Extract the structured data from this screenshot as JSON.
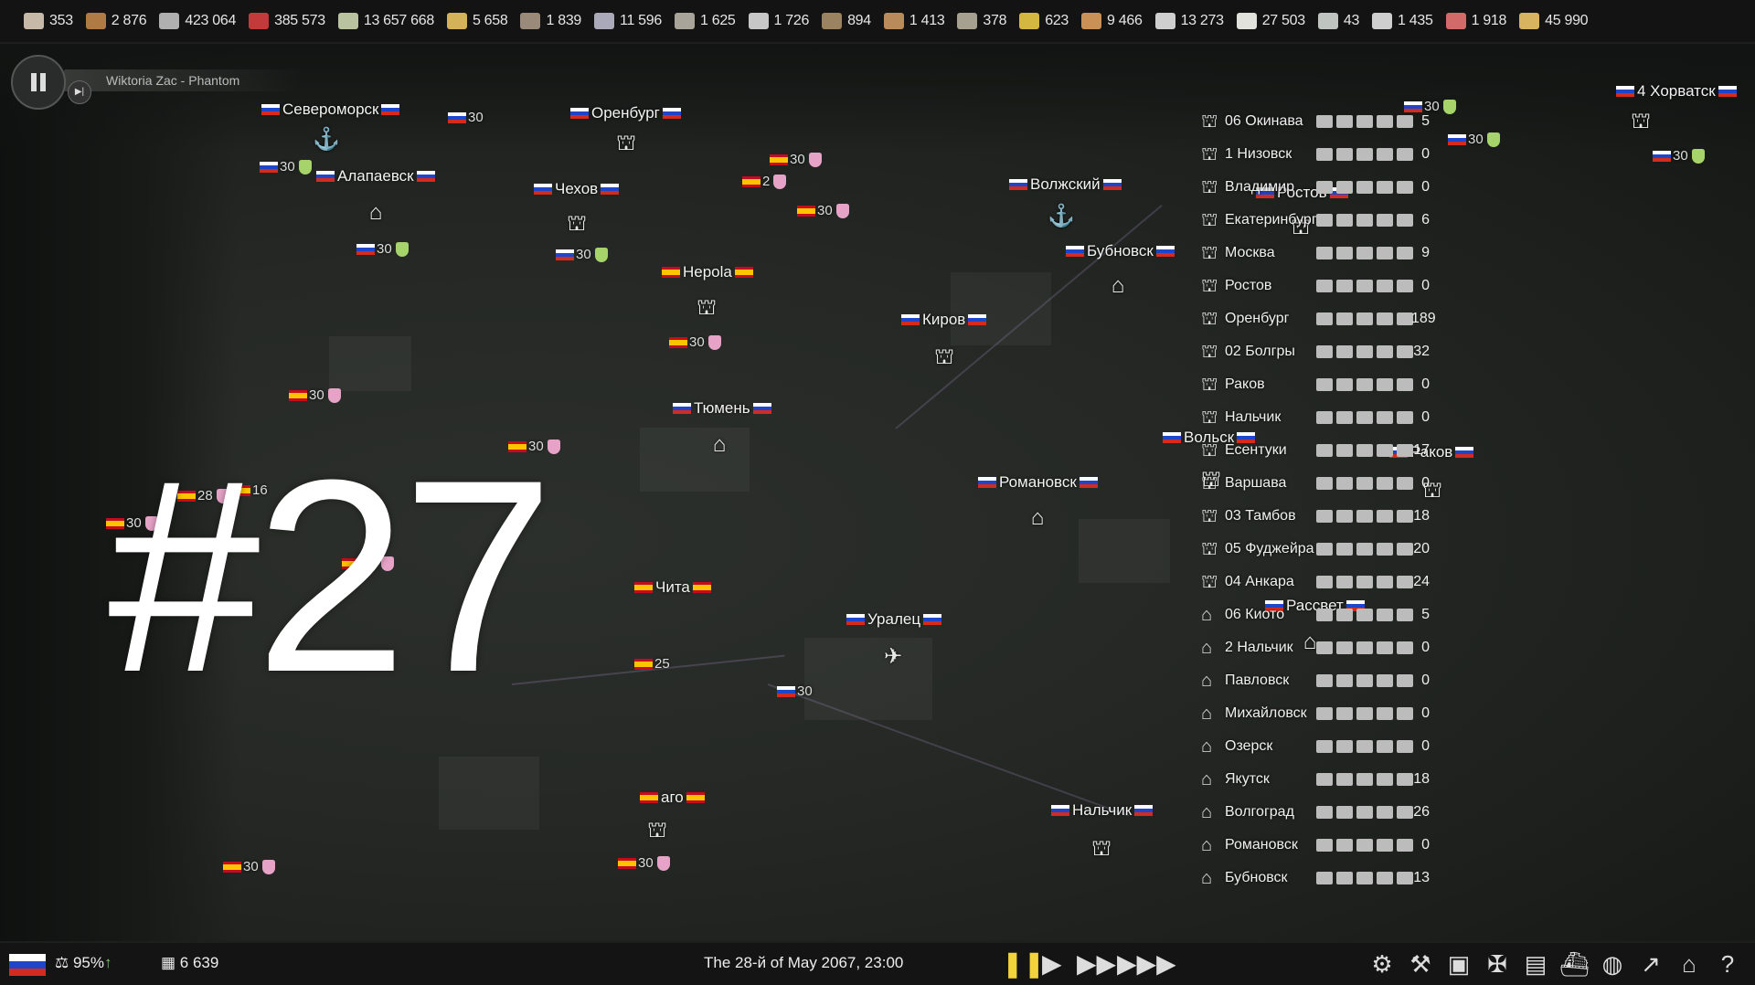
{
  "resources": [
    {
      "icon": "paper-icon",
      "value": "353",
      "color": "#c7b9a8"
    },
    {
      "icon": "wood-icon",
      "value": "2 876",
      "color": "#b07a45"
    },
    {
      "icon": "feather-icon",
      "value": "423 064",
      "color": "#b0b0b0"
    },
    {
      "icon": "meat-red-icon",
      "value": "385 573",
      "color": "#c23a3a"
    },
    {
      "icon": "money-icon",
      "value": "13 657 668",
      "color": "#b9c3a0"
    },
    {
      "icon": "wheat-icon",
      "value": "5 658",
      "color": "#d4b25a"
    },
    {
      "icon": "rubble-icon",
      "value": "1 839",
      "color": "#9a8a7a"
    },
    {
      "icon": "steel-icon",
      "value": "11 596",
      "color": "#a9a9b9"
    },
    {
      "icon": "gravel-icon",
      "value": "1 625",
      "color": "#a8a49a"
    },
    {
      "icon": "metal-sheet-icon",
      "value": "1 726",
      "color": "#c7c7c7"
    },
    {
      "icon": "ore-icon",
      "value": "894",
      "color": "#9b8260"
    },
    {
      "icon": "plank-icon",
      "value": "1 413",
      "color": "#b98a5a"
    },
    {
      "icon": "coal-icon",
      "value": "378",
      "color": "#a5a090"
    },
    {
      "icon": "gold-icon",
      "value": "623",
      "color": "#d4b740"
    },
    {
      "icon": "bread-icon",
      "value": "9 466",
      "color": "#c99155"
    },
    {
      "icon": "concrete-icon",
      "value": "13 273",
      "color": "#cfcfcf"
    },
    {
      "icon": "cotton-icon",
      "value": "27 503",
      "color": "#e2e2dc"
    },
    {
      "icon": "fabric-icon",
      "value": "43",
      "color": "#c0c4c0"
    },
    {
      "icon": "bottle-icon",
      "value": "1 435",
      "color": "#cfcfcf"
    },
    {
      "icon": "meat-icon",
      "value": "1 918",
      "color": "#d36a6a"
    },
    {
      "icon": "grain-icon",
      "value": "45 990",
      "color": "#d9b460"
    }
  ],
  "music": {
    "track": "Wiktoria Zac - Phantom"
  },
  "cities": [
    {
      "name": "Североморск",
      "f": "ru"
    },
    {
      "name": "Оренбург",
      "f": "ru"
    },
    {
      "name": "Алапаевск",
      "f": "ru"
    },
    {
      "name": "Чехов",
      "f": "ru"
    },
    {
      "name": "Волжский",
      "f": "ru"
    },
    {
      "name": "Ростов",
      "f": "ru"
    },
    {
      "name": "Бубновск",
      "f": "ru"
    },
    {
      "name": "Нерola",
      "f": "es"
    },
    {
      "name": "Киров",
      "f": "ru"
    },
    {
      "name": "Тюмень",
      "f": "ru"
    },
    {
      "name": "Вольск",
      "f": "ru"
    },
    {
      "name": "Раков",
      "f": "ru"
    },
    {
      "name": "Романовск",
      "f": "ru"
    },
    {
      "name": "Чита",
      "f": "es"
    },
    {
      "name": "Уралец",
      "f": "ru"
    },
    {
      "name": "Рассвет",
      "f": "ru"
    },
    {
      "name": "аго",
      "f": "es"
    },
    {
      "name": "Нальчик",
      "f": "ru"
    },
    {
      "name": "4 Хорватск",
      "f": "ru"
    }
  ],
  "units": [
    {
      "f": "ru",
      "n": "30",
      "s": "g"
    },
    {
      "f": "ru",
      "n": "30",
      "s": ""
    },
    {
      "f": "ru",
      "n": "30",
      "s": "g"
    },
    {
      "f": "ru",
      "n": "30",
      "s": "g"
    },
    {
      "f": "es",
      "n": "30",
      "s": "p"
    },
    {
      "f": "es",
      "n": "2",
      "s": "p"
    },
    {
      "f": "es",
      "n": "30",
      "s": "p"
    },
    {
      "f": "es",
      "n": "30",
      "s": "p"
    },
    {
      "f": "es",
      "n": "30",
      "s": "p"
    },
    {
      "f": "es",
      "n": "30",
      "s": "p"
    },
    {
      "f": "es",
      "n": "28",
      "s": "p"
    },
    {
      "f": "es",
      "n": "16",
      "s": ""
    },
    {
      "f": "es",
      "n": "30",
      "s": "p"
    },
    {
      "f": "es",
      "n": "30",
      "s": "p"
    },
    {
      "f": "es",
      "n": "25",
      "s": ""
    },
    {
      "f": "ru",
      "n": "30",
      "s": ""
    },
    {
      "f": "es",
      "n": "30",
      "s": "p"
    },
    {
      "f": "es",
      "n": "30",
      "s": "p"
    },
    {
      "f": "ru",
      "n": "30",
      "s": "g"
    },
    {
      "f": "ru",
      "n": "30",
      "s": "g"
    },
    {
      "f": "ru",
      "n": "30",
      "s": "g"
    }
  ],
  "overlay_text": "#27",
  "panel": [
    {
      "name": "06 Окинава",
      "value": "5"
    },
    {
      "name": "1 Низовск",
      "value": "0"
    },
    {
      "name": "Владимир",
      "value": "0"
    },
    {
      "name": "Екатеринбург",
      "value": "6"
    },
    {
      "name": "Москва",
      "value": "9"
    },
    {
      "name": "Ростов",
      "value": "0"
    },
    {
      "name": "Оренбург",
      "value": "189"
    },
    {
      "name": "02 Болгры",
      "value": "32"
    },
    {
      "name": "Раков",
      "value": "0"
    },
    {
      "name": "Нальчик",
      "value": "0"
    },
    {
      "name": "Есентуки",
      "value": "17"
    },
    {
      "name": "Варшава",
      "value": "0"
    },
    {
      "name": "03 Тамбов",
      "value": "18"
    },
    {
      "name": "05 Фуджейра",
      "value": "20"
    },
    {
      "name": "04 Анкара",
      "value": "24"
    },
    {
      "name": "06 Киото",
      "value": "5"
    },
    {
      "name": "2 Нальчик",
      "value": "0"
    },
    {
      "name": "Павловск",
      "value": "0"
    },
    {
      "name": "Михайловск",
      "value": "0"
    },
    {
      "name": "Озерск",
      "value": "0"
    },
    {
      "name": "Якутск",
      "value": "18"
    },
    {
      "name": "Волгоград",
      "value": "26"
    },
    {
      "name": "Романовск",
      "value": "0"
    },
    {
      "name": "Бубновск",
      "value": "13"
    }
  ],
  "bottom": {
    "approval": "95%",
    "population": "6 639",
    "date": "The 28-й of May 2067, 23:00"
  }
}
